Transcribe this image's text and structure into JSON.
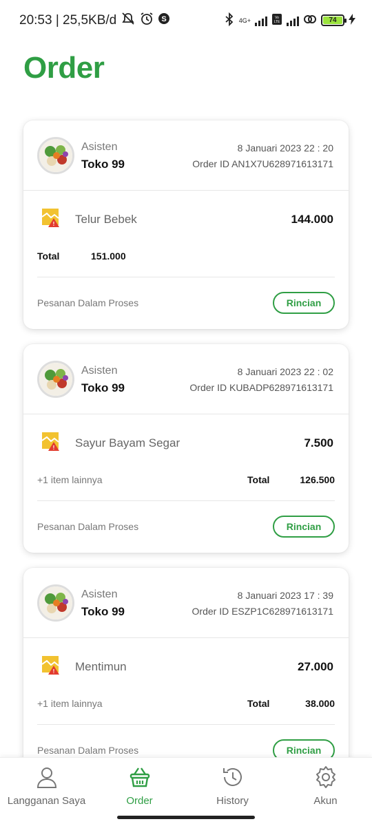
{
  "status_bar": {
    "time_speed": "20:53 | 25,5KB/d",
    "network_label": "4G+",
    "battery": "74"
  },
  "page": {
    "title": "Order"
  },
  "orders": [
    {
      "store_label": "Asisten",
      "store_name": "Toko 99",
      "date": "8 Januari 2023 22 : 20",
      "order_id": "Order ID AN1X7U628971613171",
      "item_name": "Telur Bebek",
      "item_price": "144.000",
      "more_items": "",
      "total_label": "Total",
      "total_value": "151.000",
      "status": "Pesanan Dalam Proses",
      "detail_button": "Rincian"
    },
    {
      "store_label": "Asisten",
      "store_name": "Toko 99",
      "date": "8 Januari 2023 22 : 02",
      "order_id": "Order ID KUBADP628971613171",
      "item_name": "Sayur Bayam Segar",
      "item_price": "7.500",
      "more_items": "+1 item lainnya",
      "total_label": "Total",
      "total_value": "126.500",
      "status": "Pesanan Dalam Proses",
      "detail_button": "Rincian"
    },
    {
      "store_label": "Asisten",
      "store_name": "Toko 99",
      "date": "8 Januari 2023 17 : 39",
      "order_id": "Order ID ESZP1C628971613171",
      "item_name": "Mentimun",
      "item_price": "27.000",
      "more_items": "+1 item lainnya",
      "total_label": "Total",
      "total_value": "38.000",
      "status": "Pesanan Dalam Proses",
      "detail_button": "Rincian"
    }
  ],
  "bottom_nav": {
    "items": [
      {
        "label": "Langganan Saya",
        "icon": "user-icon",
        "active": false
      },
      {
        "label": "Order",
        "icon": "basket-icon",
        "active": true
      },
      {
        "label": "History",
        "icon": "history-icon",
        "active": false
      },
      {
        "label": "Akun",
        "icon": "gear-icon",
        "active": false
      }
    ]
  },
  "colors": {
    "accent": "#2f9e44",
    "muted_text": "#777777",
    "battery": "#9be33d"
  }
}
